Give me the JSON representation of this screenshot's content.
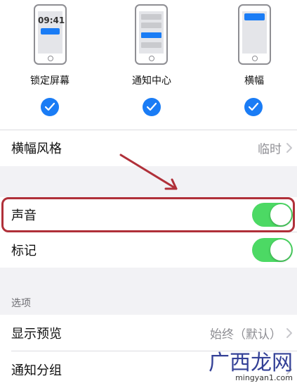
{
  "styles": {
    "options": [
      {
        "label": "锁定屏幕",
        "selected": true
      },
      {
        "label": "通知中心",
        "selected": true
      },
      {
        "label": "横幅",
        "selected": true
      }
    ],
    "lock_time": "09:41"
  },
  "banner_style": {
    "label": "横幅风格",
    "value": "临时"
  },
  "sounds": {
    "label": "声音",
    "on": true
  },
  "badges": {
    "label": "标记",
    "on": true
  },
  "options_section": {
    "header": "选项"
  },
  "show_previews": {
    "label": "显示预览",
    "value": "始终（默认）"
  },
  "notification_grouping": {
    "label": "通知分组"
  },
  "watermark": {
    "main": "广西龙网",
    "sub": "mingyan1.com"
  },
  "colors": {
    "accent": "#1a7cf5",
    "toggle_on": "#4cd964",
    "highlight": "#b03039"
  }
}
